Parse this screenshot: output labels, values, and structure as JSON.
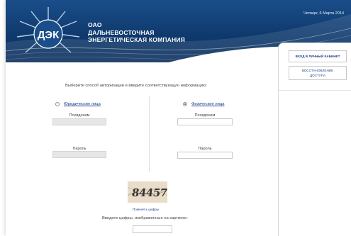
{
  "header": {
    "logo_text": "ДЭК",
    "company_lines": [
      "ОАО",
      "ДАЛЬНЕВОСТОЧНАЯ",
      "ЭНЕРГЕТИЧЕСКАЯ КОМПАНИЯ"
    ],
    "date": "Четверг, 6 Марта 2014"
  },
  "right_panel": {
    "login_label": "ВХОД В ЛИЧНЫЙ КАБИНЕТ",
    "restore_line1": "ВОССТАНОВЛЕНИЕ",
    "restore_line2": "ДОСТУПА"
  },
  "main": {
    "instruction": "Выберите способ авторизации и введите соответствующую информацию:",
    "left": {
      "radio_label": "Юридические лица",
      "radio_checked": false,
      "login_label": "Псевдоним",
      "login_value": "",
      "password_label": "Пароль",
      "password_value": ""
    },
    "right": {
      "radio_label": "Физические лица",
      "radio_checked": true,
      "login_label": "Псевдоним",
      "login_value": "",
      "password_label": "Пароль",
      "password_value": ""
    },
    "captcha": {
      "image_text": "84457",
      "change_link": "Поменять цифры",
      "prompt": "Введите цифры, изображенные на картинке:",
      "value": ""
    }
  }
}
